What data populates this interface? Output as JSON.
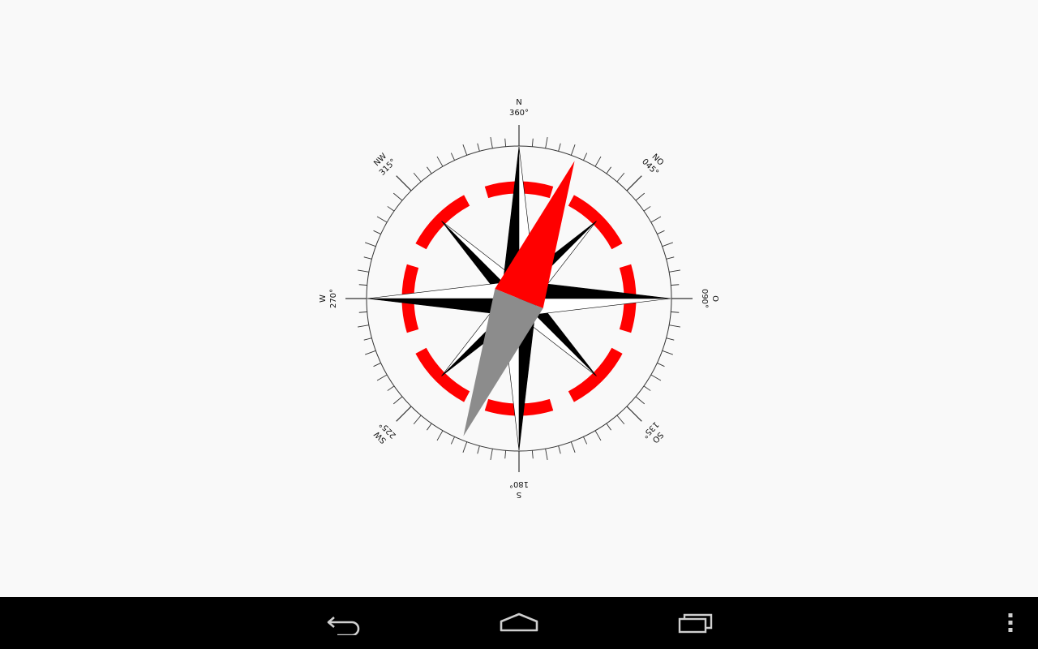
{
  "compass": {
    "labels": {
      "n": {
        "name": "N",
        "deg": "360°"
      },
      "ne": {
        "name": "NO",
        "deg": "045°"
      },
      "e": {
        "name": "O",
        "deg": "090°"
      },
      "se": {
        "name": "SO",
        "deg": "135°"
      },
      "s": {
        "name": "S",
        "deg": "180°"
      },
      "sw": {
        "name": "SW",
        "deg": "225°"
      },
      "w": {
        "name": "W",
        "deg": "270°"
      },
      "nw": {
        "name": "NW",
        "deg": "315°"
      }
    },
    "needle_heading_deg": 22,
    "colors": {
      "needle_north": "#ff0000",
      "needle_south": "#8c8c8c",
      "ring": "#ff0000",
      "rose": "#000000",
      "background": "#f9f9f9"
    }
  },
  "nav_bar": {
    "buttons": [
      "back-icon",
      "home-icon",
      "recent-apps-icon",
      "overflow-menu-icon"
    ]
  }
}
